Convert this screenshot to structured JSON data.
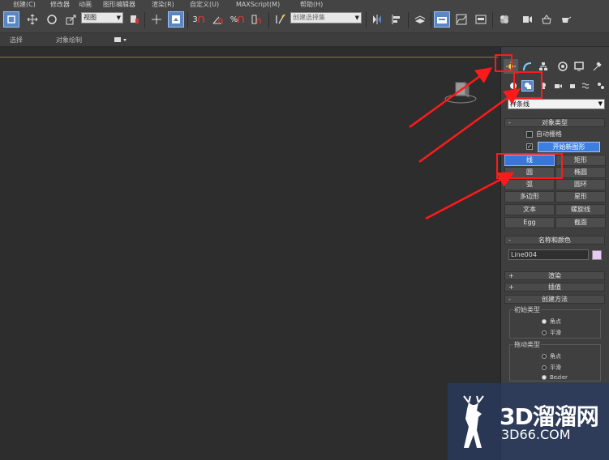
{
  "menubar": {
    "items": [
      "创建(C)",
      "修改器",
      "动画",
      "图形编辑器",
      "渲染(R)",
      "自定义(U)",
      "MAXScript(M)",
      "帮助(H)"
    ]
  },
  "toolbar": {
    "view_dropdown": "视图",
    "selection_set_dropdown": "创建选择集",
    "snap_label": "3",
    "percent_snap_label": "%"
  },
  "ribbon": {
    "tabs": [
      "选择",
      "对象绘制"
    ]
  },
  "command_panel": {
    "category_dropdown": "样条线",
    "object_type": {
      "header": "对象类型",
      "auto_grid_label": "自动栅格",
      "start_new_shape_label": "开始新图形",
      "start_new_shape_checked": true,
      "auto_grid_checked": false,
      "buttons": [
        [
          "线",
          "矩形"
        ],
        [
          "圆",
          "椭圆"
        ],
        [
          "弧",
          "圆环"
        ],
        [
          "多边形",
          "星形"
        ],
        [
          "文本",
          "螺旋线"
        ],
        [
          "Egg",
          "截面"
        ]
      ]
    },
    "name_color": {
      "header": "名称和颜色",
      "name_value": "Line004",
      "color": "#e8c8f4"
    },
    "rendering_header": "渲染",
    "interpolation_header": "插值",
    "creation_method": {
      "header": "创建方法",
      "initial_type_title": "初始类型",
      "initial_options": [
        "角点",
        "平滑"
      ],
      "initial_selected": "角点",
      "drag_type_title": "拖动类型",
      "drag_options": [
        "角点",
        "平滑",
        "Bezier"
      ],
      "drag_selected": "Bezier"
    }
  },
  "watermark": {
    "main": "3D溜溜网",
    "sub": "3D66.COM"
  },
  "colors": {
    "accent_blue": "#3c7fe0",
    "annotation_red": "#ff1a1a"
  }
}
